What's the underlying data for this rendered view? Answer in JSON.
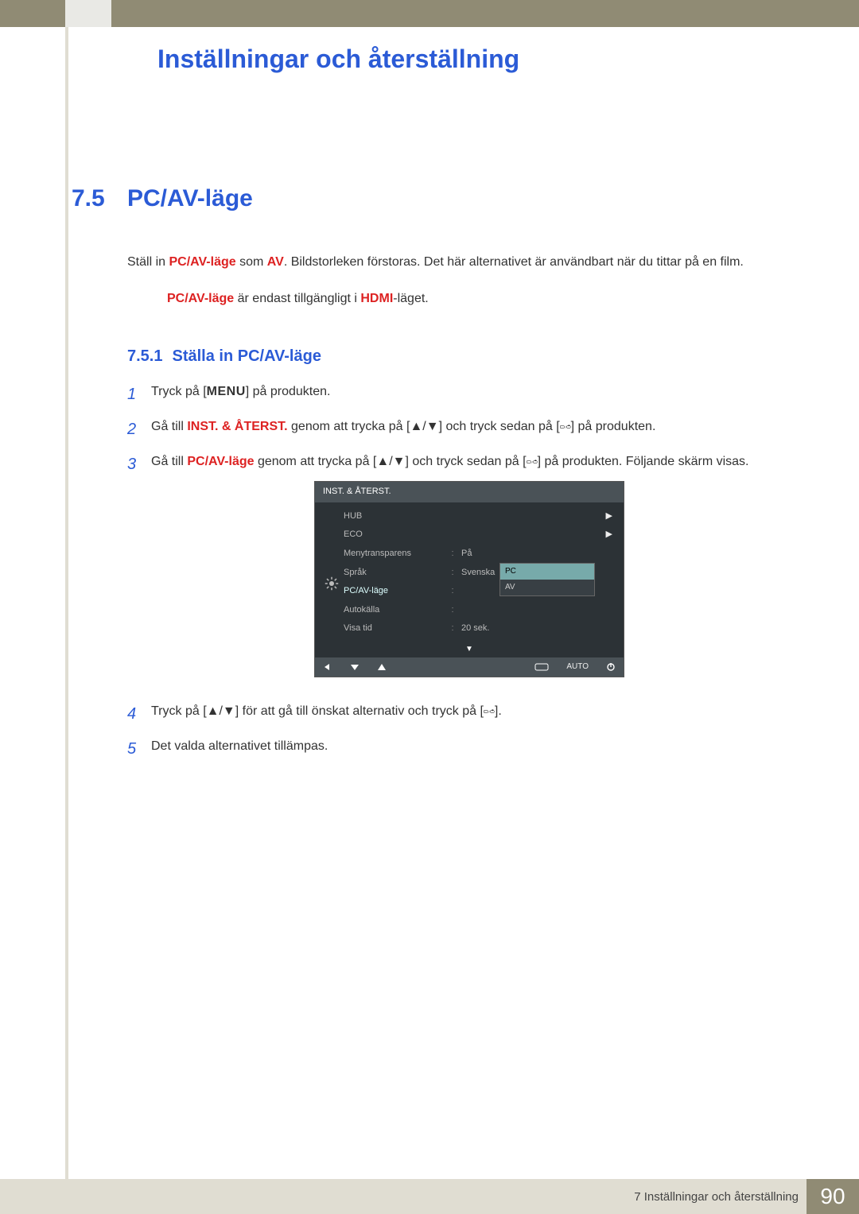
{
  "chapter_title": "Inställningar och återställning",
  "section": {
    "num": "7.5",
    "title": "PC/AV-läge"
  },
  "intro": {
    "pre1": "Ställ in ",
    "kw1": "PC/AV-läge",
    "mid1": " som ",
    "kw2": "AV",
    "post1": ". Bildstorleken förstoras. Det här alternativet är användbart när du tittar på en film."
  },
  "note": {
    "kw1": "PC/AV-läge",
    "mid": " är endast tillgängligt i ",
    "kw2": "HDMI",
    "post": "-läget."
  },
  "subsection": {
    "num": "7.5.1",
    "title": "Ställa in PC/AV-läge"
  },
  "steps": {
    "s1": {
      "n": "1",
      "pre": "Tryck på [",
      "menu": "MENU",
      "post": "] på produkten."
    },
    "s2": {
      "n": "2",
      "pre": "Gå till ",
      "kw": "INST. & ÅTERST.",
      "mid": " genom att trycka på [",
      "arrows": "▲/▼",
      "mid2": "] och tryck sedan på [",
      "post": "] på produkten."
    },
    "s3": {
      "n": "3",
      "pre": "Gå till ",
      "kw": "PC/AV-läge",
      "mid": " genom att trycka på [",
      "arrows": "▲/▼",
      "mid2": "] och tryck sedan på [",
      "post": "] på produkten. Följande skärm visas."
    },
    "s4": {
      "n": "4",
      "pre": "Tryck på [",
      "arrows": "▲/▼",
      "mid": "] för att gå till önskat alternativ och tryck på [",
      "post": "]."
    },
    "s5": {
      "n": "5",
      "text": "Det valda alternativet tillämpas."
    }
  },
  "osd": {
    "title": "INST. & ÅTERST.",
    "rows": [
      {
        "label": "HUB",
        "colon": "",
        "val": "",
        "arrow": "▶"
      },
      {
        "label": "ECO",
        "colon": "",
        "val": "",
        "arrow": "▶"
      },
      {
        "label": "Menytransparens",
        "colon": ":",
        "val": "På",
        "arrow": ""
      },
      {
        "label": "Språk",
        "colon": ":",
        "val": "Svenska",
        "arrow": ""
      },
      {
        "label": "PC/AV-läge",
        "colon": ":",
        "val": "",
        "arrow": "",
        "sel": true
      },
      {
        "label": "Autokälla",
        "colon": ":",
        "val": "",
        "arrow": ""
      },
      {
        "label": "Visa tid",
        "colon": ":",
        "val": "20 sek.",
        "arrow": ""
      }
    ],
    "dropdown": {
      "opt1": "PC",
      "opt2": "AV"
    },
    "footer_auto": "AUTO"
  },
  "footer": {
    "text": "7 Inställningar och återställning",
    "page": "90"
  }
}
